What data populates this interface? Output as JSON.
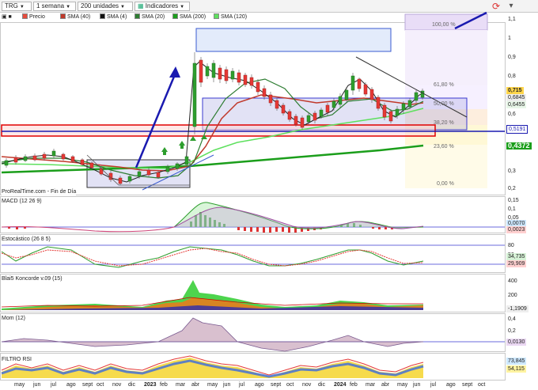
{
  "toolbar": {
    "ticker": "TRG",
    "timeframe": "1 semana",
    "units": "200 unidades",
    "indicators": "Indicadores"
  },
  "legend": [
    {
      "label": "Precio",
      "color": "#e64b3c"
    },
    {
      "label": "SMA (40)",
      "color": "#c0392b"
    },
    {
      "label": "SMA (4)",
      "color": "#111111"
    },
    {
      "label": "SMA (20)",
      "color": "#2e7d32"
    },
    {
      "label": "SMA (200)",
      "color": "#1b9e1b"
    },
    {
      "label": "SMA (120)",
      "color": "#5ee05e"
    }
  ],
  "watermark": "ProRealTime.com - Fin de Día",
  "price_axis": [
    "1,1",
    "1",
    "0,9",
    "0,8",
    "0,7",
    "0,6",
    "0,5",
    "0,4",
    "0,3",
    "0,2"
  ],
  "price_tags": {
    "last": "0,715",
    "sma4": "0,6845",
    "sma40": "0,6455",
    "support": "0,5191",
    "sma200": "0,4372"
  },
  "fib_levels": [
    "100,00 %",
    "61,80 %",
    "50,00 %",
    "38,20 %",
    "23,60 %",
    "0,00 %"
  ],
  "panels": {
    "macd": {
      "title": "MACD (12 26 9)",
      "axis": [
        "0,15",
        "0,1",
        "0,05"
      ],
      "tags": [
        "0,0070",
        "0,0023"
      ]
    },
    "stoch": {
      "title": "Estocástico (26 8 5)",
      "axis": [
        "80",
        "50",
        "20"
      ],
      "tags": [
        "34,735",
        "29,909"
      ]
    },
    "koncorde": {
      "title": "Blai5 Koncorde v.09 (15)",
      "axis": [
        "400",
        "200",
        "0"
      ],
      "tags": [
        "-1,1909"
      ]
    },
    "mom": {
      "title": "Mom (12)",
      "axis": [
        "0,4",
        "0,2",
        "0",
        "-0,2"
      ],
      "tags": [
        "0,0130"
      ]
    },
    "rsi": {
      "title": "FILTRO RSI",
      "axis": [
        "60",
        "40"
      ],
      "tags": [
        "73,845",
        "54,115"
      ]
    }
  },
  "x_axis": [
    "may",
    "jun",
    "jul",
    "ago",
    "sept",
    "oct",
    "nov",
    "dic",
    "2023",
    "feb",
    "mar",
    "abr",
    "may",
    "jun",
    "jul",
    "ago",
    "sept",
    "oct",
    "nov",
    "dic",
    "2024",
    "feb",
    "mar",
    "abr",
    "may",
    "jun",
    "jul",
    "ago",
    "sept",
    "oct"
  ],
  "colors": {
    "bull": "#2e9e2e",
    "bear": "#e53935",
    "accent": "#1a1ab0",
    "tag_green": "#1a9e1a"
  }
}
